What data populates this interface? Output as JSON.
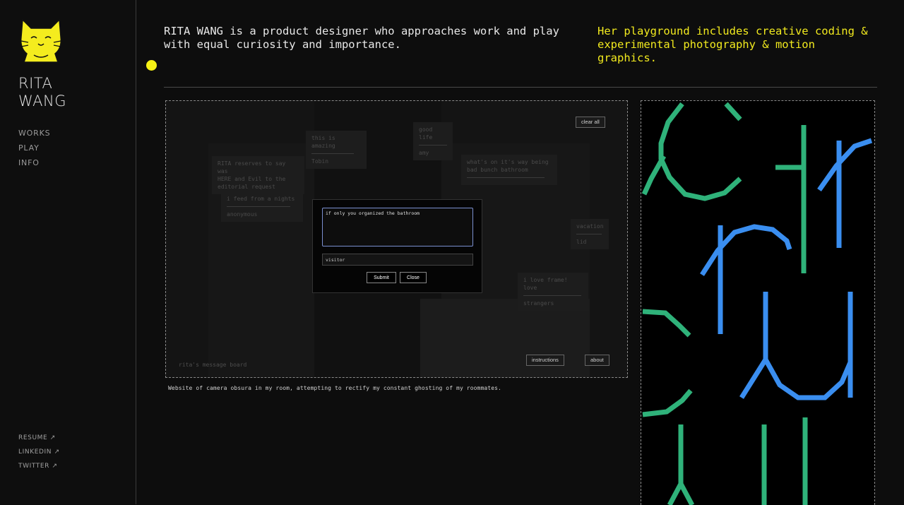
{
  "brand": {
    "line1": "RITA",
    "line2": "WANG"
  },
  "nav": [
    {
      "label": "WORKS"
    },
    {
      "label": "PLAY"
    },
    {
      "label": "INFO"
    }
  ],
  "external": [
    {
      "label": "RESUME ↗"
    },
    {
      "label": "LINKEDIN ↗"
    },
    {
      "label": "TWITTER ↗"
    }
  ],
  "intro": {
    "main": "RITA WANG is a product designer who approaches work and play with equal curiosity and importance.",
    "side": "Her playground includes creative coding & experimental photography & motion graphics."
  },
  "project": {
    "clear_all": "clear all",
    "instructions": "instructions",
    "about": "about",
    "board_label": "rita's message board",
    "notes": [
      {
        "lines": [
          "RITA reserves to say was",
          "HERE and Evil to the",
          "editorial request"
        ]
      },
      {
        "lines": [
          "this is amazing",
          "Tobin"
        ]
      },
      {
        "lines": [
          "good life",
          "amy"
        ]
      },
      {
        "lines": [
          "what's on it's way being",
          "bad bunch bathroom"
        ]
      },
      {
        "lines": [
          "i feed from a nights",
          "anonymous"
        ]
      },
      {
        "lines": [
          "vacation",
          "lid"
        ]
      },
      {
        "lines": [
          "i love frame! love",
          "strangers"
        ]
      }
    ],
    "modal": {
      "message": "if only you organized the bathroom",
      "name": "visitor",
      "submit": "Submit",
      "close": "Close"
    },
    "caption": "Website of camera obsura in my room, attempting to rectify my constant ghosting of my roommates."
  },
  "colors": {
    "accent_yellow": "#f6f115",
    "art_green": "#2fb27a",
    "art_blue": "#3a8ef0"
  }
}
